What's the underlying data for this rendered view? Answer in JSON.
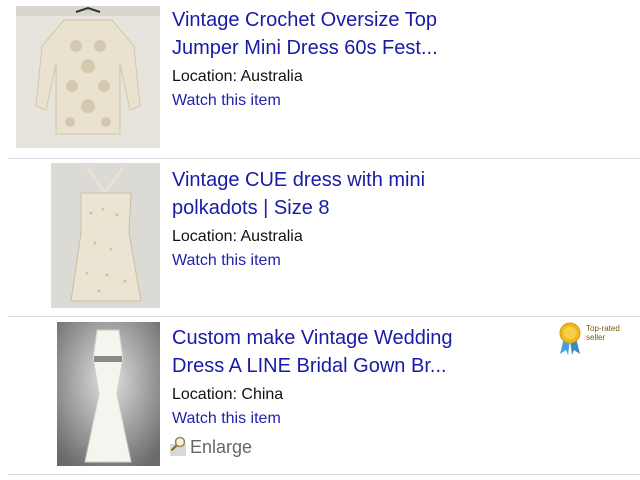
{
  "listings": [
    {
      "title": "Vintage Crochet Oversize Top Jumper Mini Dress 60s Fest...",
      "location": "Location: Australia",
      "watch": "Watch this item",
      "image_icon": "crochet-dress-photo"
    },
    {
      "title": "Vintage CUE dress with mini polkadots | Size 8",
      "location": "Location: Australia",
      "watch": "Watch this item",
      "image_icon": "strapless-dress-photo"
    },
    {
      "title": "Custom make Vintage Wedding Dress A LINE Bridal Gown Br...",
      "location": "Location: China",
      "watch": "Watch this item",
      "enlarge": "Enlarge",
      "badge": "Top-rated seller",
      "image_icon": "wedding-gown-photo"
    }
  ],
  "colors": {
    "link": "#1a1aa6",
    "divider": "#d9d9d9",
    "badge_gold": "#f0b81c"
  }
}
